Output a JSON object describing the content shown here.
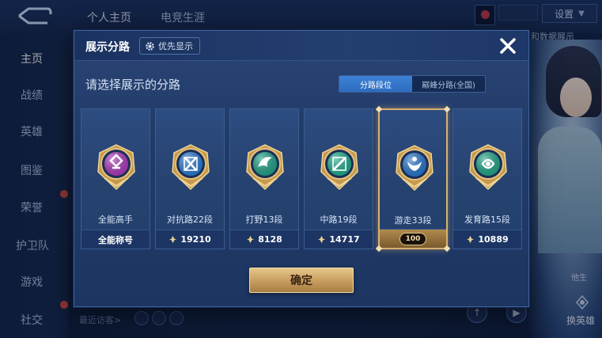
{
  "background": {
    "top_tabs": [
      "个人主页",
      "电竞生涯"
    ],
    "settings_label": "设置",
    "right_hint": "权和数据展示",
    "sidebar_items": [
      "主页",
      "战绩",
      "英雄",
      "图鉴",
      "荣誉",
      "护卫队",
      "游戏",
      "社交"
    ],
    "recent_visitors_label": "最近访客>",
    "char_labels": [
      "他生",
      "换英雄"
    ]
  },
  "modal": {
    "title": "展示分路",
    "priority_label": "优先显示",
    "prompt": "请选择展示的分路",
    "tabs": [
      {
        "label": "分路段位",
        "active": true
      },
      {
        "label": "巅峰分路(全国)",
        "active": false
      }
    ],
    "cards": [
      {
        "role": "全能高手",
        "footer": "全能称号",
        "icon": "all-round-emblem-icon",
        "color": "#b03cc0",
        "selected": false,
        "has_points": false
      },
      {
        "role": "对抗路22段",
        "footer": "19210",
        "icon": "clash-lane-emblem-icon",
        "color": "#2f7fd6",
        "selected": false,
        "has_points": true
      },
      {
        "role": "打野13段",
        "footer": "8128",
        "icon": "jungle-emblem-icon",
        "color": "#23a68b",
        "selected": false,
        "has_points": true
      },
      {
        "role": "中路19段",
        "footer": "14717",
        "icon": "mid-lane-emblem-icon",
        "color": "#1fae8f",
        "selected": false,
        "has_points": true
      },
      {
        "role": "游走33段",
        "footer": "100",
        "icon": "roam-emblem-icon",
        "color": "#2a79d0",
        "selected": true,
        "has_points": false
      },
      {
        "role": "发育路15段",
        "footer": "10889",
        "icon": "farm-lane-emblem-icon",
        "color": "#22a98a",
        "selected": false,
        "has_points": true
      }
    ],
    "confirm_label": "确定"
  },
  "colors": {
    "gold": "#d9b070",
    "accent_blue": "#2e6cbf",
    "panel": "#213b68"
  }
}
